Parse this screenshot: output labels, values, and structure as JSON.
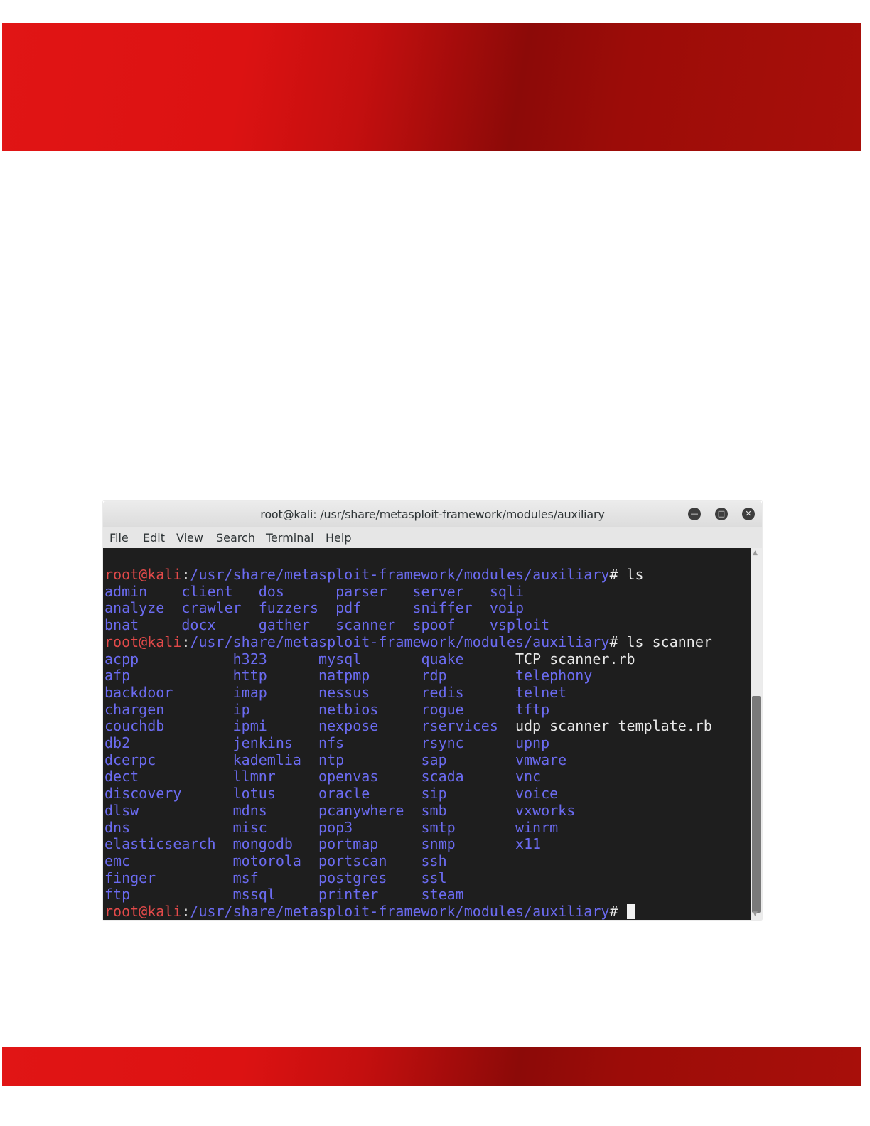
{
  "window": {
    "title": "root@kali: /usr/share/metasploit-framework/modules/auxiliary"
  },
  "menu": [
    "File",
    "Edit",
    "View",
    "Search",
    "Terminal",
    "Help"
  ],
  "colors": {
    "prompt_user": "#e34a4a",
    "prompt_path": "#6b6bf0",
    "directory": "#6b6bf0",
    "file": "#e8e8e8",
    "background": "#1e1e1e"
  },
  "terminal_lines": [
    [
      {
        "t": "root@kali",
        "c": "user"
      },
      {
        "t": ":",
        "c": "plain"
      },
      {
        "t": "/usr/share/metasploit-framework/modules/auxiliary",
        "c": "path"
      },
      {
        "t": "# ls",
        "c": "plain"
      }
    ],
    [
      {
        "t": "admin    client   dos      parser   server   sqli",
        "c": "dir"
      }
    ],
    [
      {
        "t": "analyze  crawler  fuzzers  pdf      sniffer  voip",
        "c": "dir"
      }
    ],
    [
      {
        "t": "bnat     docx     gather   scanner  spoof    vsploit",
        "c": "dir"
      }
    ],
    [
      {
        "t": "root@kali",
        "c": "user"
      },
      {
        "t": ":",
        "c": "plain"
      },
      {
        "t": "/usr/share/metasploit-framework/modules/auxiliary",
        "c": "path"
      },
      {
        "t": "# ls scanner",
        "c": "plain"
      }
    ],
    [
      {
        "t": "acpp           h323      mysql       quake      ",
        "c": "dir"
      },
      {
        "t": "TCP_scanner.rb",
        "c": "plain"
      }
    ],
    [
      {
        "t": "afp            http      natpmp      rdp        telephony",
        "c": "dir"
      }
    ],
    [
      {
        "t": "backdoor       imap      nessus      redis      telnet",
        "c": "dir"
      }
    ],
    [
      {
        "t": "chargen        ip        netbios     rogue      tftp",
        "c": "dir"
      }
    ],
    [
      {
        "t": "couchdb        ipmi      nexpose     rservices  ",
        "c": "dir"
      },
      {
        "t": "udp_scanner_template.rb",
        "c": "plain"
      }
    ],
    [
      {
        "t": "db2            jenkins   nfs         rsync      upnp",
        "c": "dir"
      }
    ],
    [
      {
        "t": "dcerpc         kademlia  ntp         sap        vmware",
        "c": "dir"
      }
    ],
    [
      {
        "t": "dect           llmnr     openvas     scada      vnc",
        "c": "dir"
      }
    ],
    [
      {
        "t": "discovery      lotus     oracle      sip        voice",
        "c": "dir"
      }
    ],
    [
      {
        "t": "dlsw           mdns      pcanywhere  smb        vxworks",
        "c": "dir"
      }
    ],
    [
      {
        "t": "dns            misc      pop3        smtp       winrm",
        "c": "dir"
      }
    ],
    [
      {
        "t": "elasticsearch  mongodb   portmap     snmp       x11",
        "c": "dir"
      }
    ],
    [
      {
        "t": "emc            motorola  portscan    ssh",
        "c": "dir"
      }
    ],
    [
      {
        "t": "finger         msf       postgres    ssl",
        "c": "dir"
      }
    ],
    [
      {
        "t": "ftp            mssql     printer     steam",
        "c": "dir"
      }
    ],
    [
      {
        "t": "root@kali",
        "c": "user"
      },
      {
        "t": ":",
        "c": "plain"
      },
      {
        "t": "/usr/share/metasploit-framework/modules/auxiliary",
        "c": "path"
      },
      {
        "t": "# ",
        "c": "plain"
      },
      {
        "t": "",
        "c": "cursor"
      }
    ]
  ]
}
